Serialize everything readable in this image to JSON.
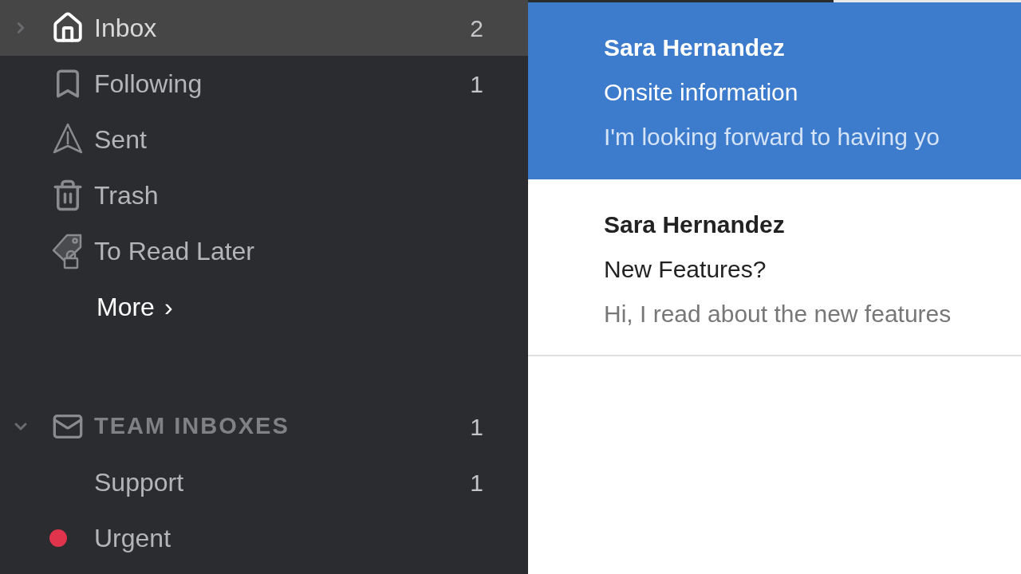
{
  "sidebar": {
    "items": [
      {
        "kind": "folder",
        "label": "Inbox",
        "count": "2",
        "selected": true,
        "expanded": false
      },
      {
        "kind": "folder",
        "label": "Following",
        "count": "1",
        "selected": false
      },
      {
        "kind": "folder",
        "label": "Sent",
        "selected": false
      },
      {
        "kind": "folder",
        "label": "Trash",
        "selected": false
      },
      {
        "kind": "folder",
        "label": "To Read Later",
        "selected": false
      },
      {
        "kind": "more",
        "label": "More",
        "chevron": "›"
      },
      {
        "kind": "section",
        "label": "TEAM INBOXES",
        "count": "1",
        "expanded": true
      },
      {
        "kind": "team",
        "label": "Support",
        "count": "1",
        "selected": false
      },
      {
        "kind": "team",
        "label": "Urgent",
        "color": "#e0334c",
        "selected": false
      }
    ]
  },
  "message_list": {
    "progress": {
      "level": 0.62
    },
    "messages": [
      {
        "sender": "Sara Hernandez",
        "subject": "Onsite information",
        "preview": "I'm looking forward to having yo",
        "selected": true
      },
      {
        "sender": "Sara Hernandez",
        "subject": "New Features?",
        "preview": "Hi, I read about the new features",
        "selected": false
      }
    ]
  }
}
